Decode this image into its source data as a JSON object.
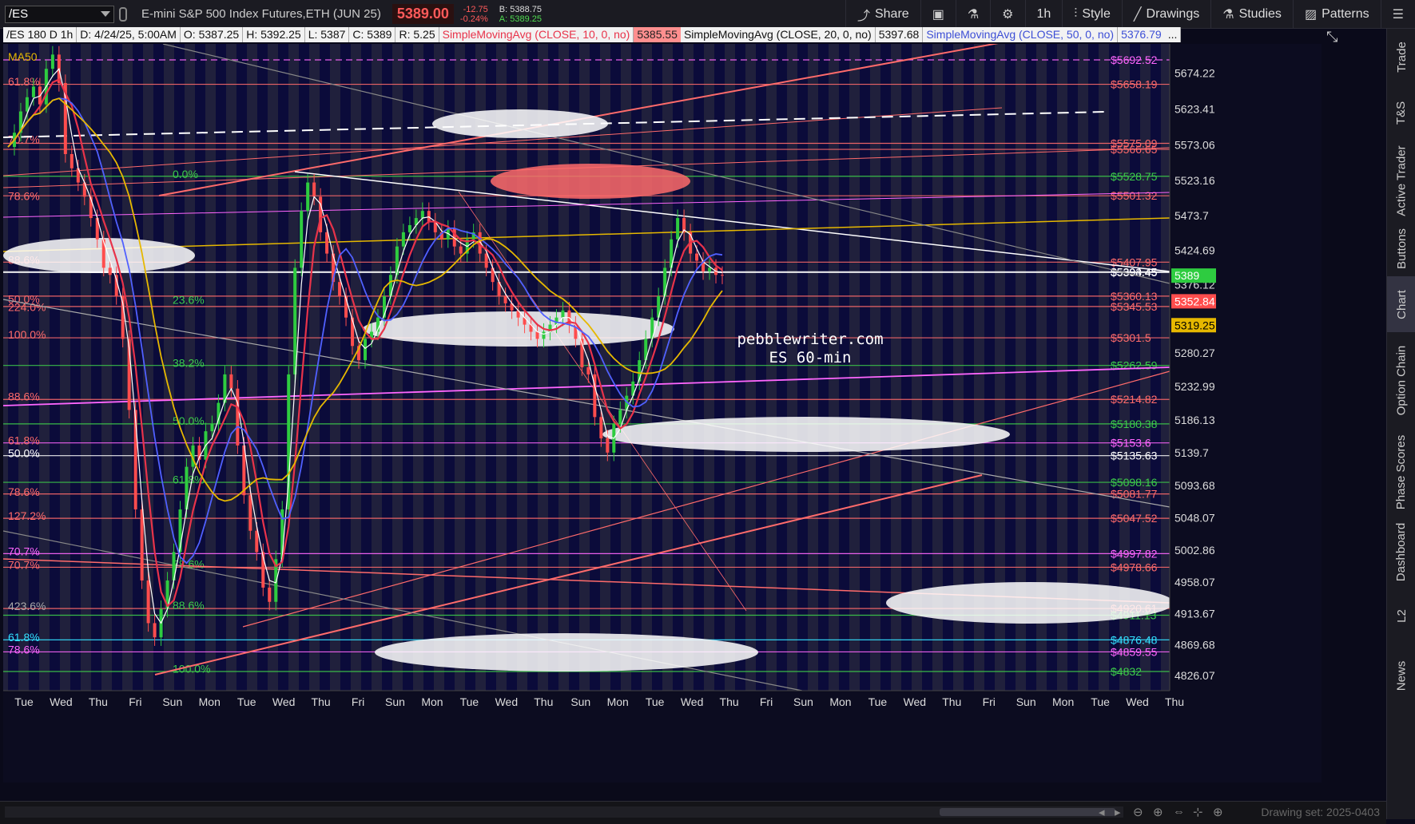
{
  "header": {
    "symbol": "/ES",
    "description": "E-mini S&P 500 Index Futures,ETH (JUN 25)",
    "last_price": "5389.00",
    "change": "-12.75",
    "change_pct": "-0.24%",
    "bid": "B: 5388.75",
    "ask": "A: 5389.25",
    "buttons": {
      "share": "Share",
      "timeframe": "1h",
      "style": "Style",
      "drawings": "Drawings",
      "studies": "Studies",
      "patterns": "Patterns"
    }
  },
  "studybar": {
    "chart_id": "/ES 180 D 1h",
    "date": "D: 4/24/25, 5:00AM",
    "open": "O: 5387.25",
    "high": "H: 5392.25",
    "low": "L: 5387",
    "close": "C: 5389",
    "range": "R: 5.25",
    "sma10_label": "SimpleMovingAvg (CLOSE, 10, 0, no)",
    "sma10_value": "5385.55",
    "sma20_label": "SimpleMovingAvg (CLOSE, 20, 0, no)",
    "sma20_value": "5397.68",
    "sma50_label": "SimpleMovingAvg (CLOSE, 50, 0, no)",
    "sma50_value": "5376.79",
    "more": "..."
  },
  "right_nav": {
    "items": [
      "Trade",
      "T&S",
      "Active Trader",
      "Buttons",
      "Chart",
      "Option Chain",
      "Phase Scores",
      "Dashboard",
      "L2",
      "News"
    ],
    "active": "Chart"
  },
  "bottom": {
    "drawing_set": "Drawing set: 2025-0403"
  },
  "watermark": {
    "line1": "pebblewriter.com",
    "line2": "ES 60-min"
  },
  "colors": {
    "background": "#20203c",
    "stripe_dark": "#08083a",
    "up_candle": "#2ecc40",
    "down_candle": "#ff4d4d",
    "sma10": "#e8334a",
    "sma20": "#ffffff",
    "sma50": "#5060ff",
    "sma200": "#e6b800",
    "fib_red": "#ff6b6b",
    "fib_green": "#3dcc4a",
    "fib_magenta": "#ff66ff"
  },
  "chart_data": {
    "type": "candlestick",
    "timeframe": "1h",
    "ylim": [
      4805,
      5715
    ],
    "y_ticks": [
      5674.22,
      5623.41,
      5573.06,
      5523.16,
      5473.7,
      5424.69,
      5376.12,
      5280.27,
      5232.99,
      5186.13,
      5139.7,
      5093.68,
      5048.07,
      5002.86,
      4958.07,
      4913.67,
      4869.68,
      4826.07
    ],
    "x_ticks": [
      "Tue",
      "Wed",
      "Thu",
      "Fri",
      "Sun",
      "Mon",
      "Tue",
      "Wed",
      "Thu",
      "Fri",
      "Sun",
      "Mon",
      "Tue",
      "Wed",
      "Thu",
      "Sun",
      "Mon",
      "Tue",
      "Wed",
      "Thu",
      "Fri",
      "Sun",
      "Mon",
      "Tue",
      "Wed",
      "Thu",
      "Fri",
      "Sun",
      "Mon",
      "Tue",
      "Wed",
      "Thu"
    ],
    "price_markers": [
      {
        "value": 5389,
        "label": "5389",
        "color": "#2ecc40",
        "text_color": "#ffffff"
      },
      {
        "value": 5352.84,
        "label": "5352.84",
        "color": "#ff4d4d",
        "text_color": "#ffffff"
      },
      {
        "value": 5319.25,
        "label": "5319.25",
        "color": "#e6b800",
        "text_color": "#000000"
      }
    ],
    "levels": [
      {
        "value": 5692.52,
        "label": "$5692.52",
        "color": "#ff66ff",
        "dashed": true
      },
      {
        "value": 5658.19,
        "label": "$5658.19",
        "color": "#ff6b6b"
      },
      {
        "value": 5575.09,
        "label": "$5575.09",
        "color": "#ff6b6b"
      },
      {
        "value": 5566.65,
        "label": "$5566.65",
        "color": "#ff6b6b"
      },
      {
        "value": 5528.75,
        "label": "$5528.75",
        "color": "#3dcc4a"
      },
      {
        "value": 5501.32,
        "label": "$5501.32",
        "color": "#ff6b6b"
      },
      {
        "value": 5407.95,
        "label": "$5407.95",
        "color": "#ff6b6b"
      },
      {
        "value": 5394.45,
        "label": "$5394.45",
        "color": "#ffffff"
      },
      {
        "value": 5393.45,
        "label": "$5393.45",
        "color": "#ffffff"
      },
      {
        "value": 5360.13,
        "label": "$5360.13",
        "color": "#ff6b6b"
      },
      {
        "value": 5345.53,
        "label": "$5345.53",
        "color": "#ff6b6b"
      },
      {
        "value": 5301.5,
        "label": "$5301.5",
        "color": "#ff6b6b"
      },
      {
        "value": 5262.59,
        "label": "$5262.59",
        "color": "#3dcc4a"
      },
      {
        "value": 5214.82,
        "label": "$5214.82",
        "color": "#ff6b6b"
      },
      {
        "value": 5180.38,
        "label": "$5180.38",
        "color": "#3dcc4a"
      },
      {
        "value": 5153.6,
        "label": "$5153.6",
        "color": "#ff66ff"
      },
      {
        "value": 5135.63,
        "label": "$5135.63",
        "color": "#ffffff"
      },
      {
        "value": 5098.16,
        "label": "$5098.16",
        "color": "#3dcc4a"
      },
      {
        "value": 5081.77,
        "label": "$5081.77",
        "color": "#ff6b6b"
      },
      {
        "value": 5047.52,
        "label": "$5047.52",
        "color": "#ff6b6b"
      },
      {
        "value": 4997.82,
        "label": "$4997.82",
        "color": "#ff66ff"
      },
      {
        "value": 4978.66,
        "label": "$4978.66",
        "color": "#ff6b6b"
      },
      {
        "value": 4920.61,
        "label": "$4920.61",
        "color": "#ff6b6b"
      },
      {
        "value": 4911.13,
        "label": "$4911.13",
        "color": "#3dcc4a"
      },
      {
        "value": 4876.48,
        "label": "$4876.48",
        "color": "#33e0ff"
      },
      {
        "value": 4859.55,
        "label": "$4859.55",
        "color": "#ff66ff"
      },
      {
        "value": 4832,
        "label": "$4832",
        "color": "#3dcc4a"
      }
    ],
    "fib_labels_left": [
      {
        "value": 5697,
        "label": "MA50",
        "color": "#e6b800"
      },
      {
        "value": 5662,
        "label": "61.8%",
        "color": "#ff6b6b"
      },
      {
        "value": 5581,
        "label": "70.7%",
        "color": "#ff6b6b"
      },
      {
        "value": 5501,
        "label": "78.6%",
        "color": "#ff6b6b"
      },
      {
        "value": 5411,
        "label": "88.6%",
        "color": "#ff6b6b"
      },
      {
        "value": 5356,
        "label": "50.0%",
        "color": "#ff6b6b"
      },
      {
        "value": 5345,
        "label": "224.0%",
        "color": "#ff6b6b"
      },
      {
        "value": 5306,
        "label": "100.0%",
        "color": "#ff6b6b"
      },
      {
        "value": 5219,
        "label": "88.6%",
        "color": "#ff6b6b"
      },
      {
        "value": 5157,
        "label": "61.8%",
        "color": "#ff6b6b"
      },
      {
        "value": 5139,
        "label": "50.0%",
        "color": "#ffffff"
      },
      {
        "value": 5085,
        "label": "78.6%",
        "color": "#ff6b6b"
      },
      {
        "value": 5051,
        "label": "127.2%",
        "color": "#ff6b6b"
      },
      {
        "value": 5001,
        "label": "70.7%",
        "color": "#ff66ff"
      },
      {
        "value": 4982,
        "label": "70.7%",
        "color": "#ff6b6b"
      },
      {
        "value": 4924,
        "label": "423.6%",
        "color": "#aaaaaa"
      },
      {
        "value": 4880,
        "label": "61.8%",
        "color": "#33e0ff"
      },
      {
        "value": 4863,
        "label": "78.6%",
        "color": "#ff66ff"
      }
    ],
    "fib_labels_inner": [
      {
        "value": 5532,
        "label": "0.0%",
        "color": "#3dcc4a"
      },
      {
        "value": 5355,
        "label": "23.6%",
        "color": "#3dcc4a"
      },
      {
        "value": 5266,
        "label": "38.2%",
        "color": "#3dcc4a"
      },
      {
        "value": 5185,
        "label": "50.0%",
        "color": "#3dcc4a"
      },
      {
        "value": 5102,
        "label": "61.8%",
        "color": "#3dcc4a"
      },
      {
        "value": 4983,
        "label": "78.6%",
        "color": "#3dcc4a"
      },
      {
        "value": 4925,
        "label": "88.6%",
        "color": "#3dcc4a"
      },
      {
        "value": 4836,
        "label": "100.0%",
        "color": "#3dcc4a"
      }
    ],
    "close_series": [
      5570,
      5590,
      5620,
      5640,
      5655,
      5630,
      5680,
      5700,
      5660,
      5560,
      5540,
      5520,
      5500,
      5470,
      5440,
      5400,
      5390,
      5360,
      5300,
      5200,
      5060,
      4960,
      4900,
      4880,
      4920,
      4960,
      5000,
      5060,
      5120,
      5150,
      5130,
      5170,
      5180,
      5210,
      5250,
      5230,
      5150,
      5080,
      5030,
      5000,
      4950,
      4930,
      4990,
      5060,
      5250,
      5400,
      5480,
      5520,
      5500,
      5450,
      5420,
      5380,
      5360,
      5330,
      5290,
      5270,
      5300,
      5310,
      5330,
      5360,
      5390,
      5430,
      5450,
      5460,
      5470,
      5480,
      5465,
      5450,
      5440,
      5455,
      5430,
      5420,
      5440,
      5450,
      5420,
      5400,
      5380,
      5360,
      5350,
      5340,
      5330,
      5320,
      5310,
      5300,
      5310,
      5320,
      5330,
      5340,
      5320,
      5300,
      5260,
      5250,
      5190,
      5160,
      5140,
      5180,
      5200,
      5220,
      5240,
      5270,
      5300,
      5330,
      5360,
      5400,
      5440,
      5470,
      5450,
      5420,
      5410,
      5395,
      5400,
      5390,
      5389
    ]
  }
}
